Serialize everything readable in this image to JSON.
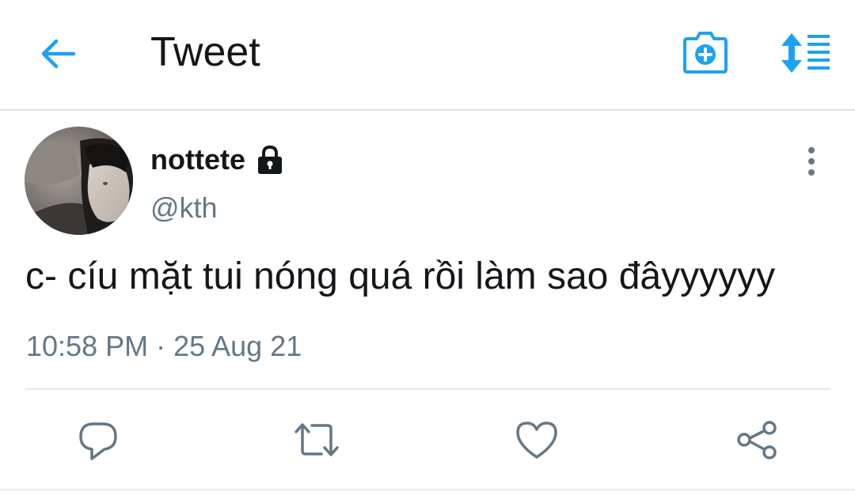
{
  "header": {
    "title": "Tweet",
    "back_icon": "arrow-left-icon",
    "camera_icon": "camera-plus-icon",
    "sort_icon": "sort-list-icon"
  },
  "tweet": {
    "display_name": "nottete",
    "protected_icon": "lock-icon",
    "handle": "@kth",
    "text": "c- cíu mặt tui nóng quá rồi làm sao đâyyyyyy",
    "timestamp": "10:58 PM · 25 Aug 21"
  },
  "actions": {
    "reply_icon": "reply-icon",
    "retweet_icon": "retweet-icon",
    "like_icon": "heart-icon",
    "share_icon": "share-icon"
  },
  "colors": {
    "accent": "#1da1f2",
    "text": "#14171a",
    "secondary": "#657786",
    "action": "#657786"
  }
}
